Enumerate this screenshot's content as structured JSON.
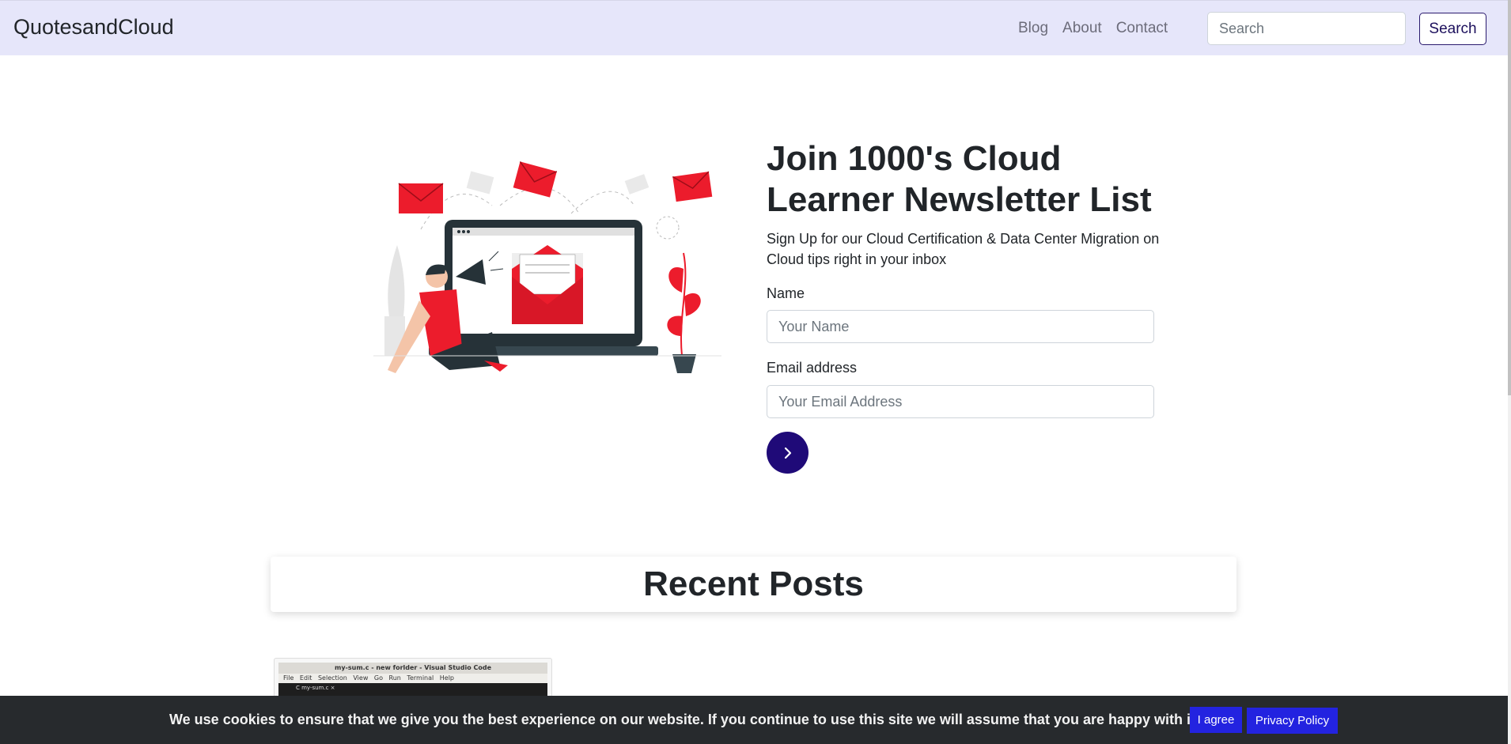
{
  "header": {
    "brand": "QuotesandCloud",
    "nav": [
      {
        "label": "Blog"
      },
      {
        "label": "About"
      },
      {
        "label": "Contact"
      }
    ],
    "search": {
      "placeholder": "Search",
      "button_label": "Search"
    }
  },
  "hero": {
    "title": "Join 1000's Cloud Learner Newsletter List",
    "subtitle": "Sign Up for our Cloud Certification & Data Center Migration on Cloud tips right in your inbox",
    "name_label": "Name",
    "name_placeholder": "Your Name",
    "email_label": "Email address",
    "email_placeholder": "Your Email Address",
    "submit_icon": "chevron-right-icon"
  },
  "recent_posts": {
    "title": "Recent Posts",
    "thumbnail": {
      "title_bar": "my-sum.c - new forlder - Visual Studio Code",
      "menu": "File Edit Selection View Go Run Terminal Help",
      "tab": "C my-sum.c ×"
    }
  },
  "cookie": {
    "message": "We use cookies to ensure that we give you the best experience on our website. If you continue to use this site we will assume that you are happy with it.",
    "agree_label": "I agree",
    "policy_label": "Privacy Policy"
  },
  "colors": {
    "navbar_bg": "#e6e6fa",
    "accent": "#1f0a78",
    "illustration_red": "#ec1c2c",
    "cookie_bg": "#272a2d",
    "cookie_button": "#2323e0"
  }
}
